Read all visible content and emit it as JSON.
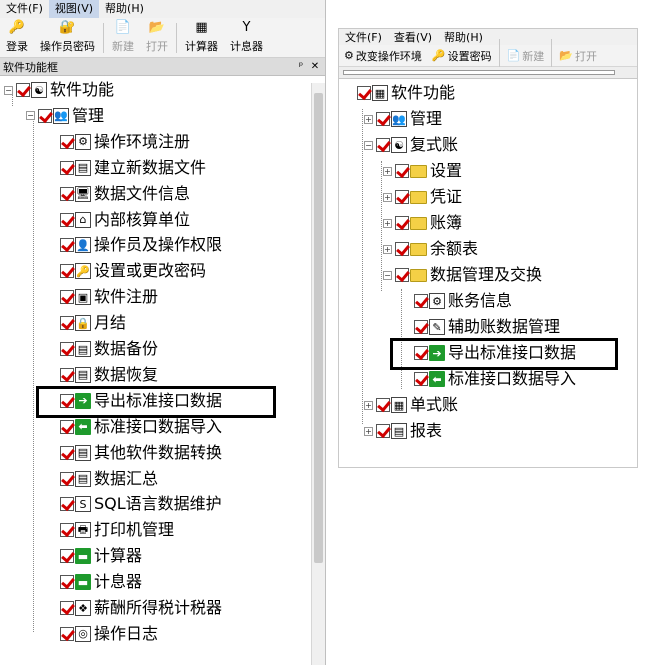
{
  "left": {
    "menu": [
      {
        "label": "文件(F)",
        "selected": false
      },
      {
        "label": "视图(V)",
        "selected": true
      },
      {
        "label": "帮助(H)",
        "selected": false
      }
    ],
    "toolbar": [
      {
        "label": "登录",
        "icon": "key-icon",
        "glyph": "🔑",
        "disabled": false
      },
      {
        "label": "操作员密码",
        "icon": "user-key-icon",
        "glyph": "🔐",
        "disabled": false
      },
      {
        "label": "新建",
        "icon": "new-file-icon",
        "glyph": "📄",
        "disabled": true
      },
      {
        "label": "打开",
        "icon": "open-folder-icon",
        "glyph": "📂",
        "disabled": true
      },
      {
        "label": "计算器",
        "icon": "calculator-icon",
        "glyph": "▦",
        "disabled": false
      },
      {
        "label": "计息器",
        "icon": "interest-calc-icon",
        "glyph": "Y",
        "disabled": false
      }
    ],
    "panel_title": "软件功能框",
    "pin_glyph": "ᵖ",
    "close_glyph": "✕",
    "tree": [
      {
        "label": "软件功能",
        "level": 0,
        "expander": "−",
        "icon": "app-icon",
        "glyph": "☯"
      },
      {
        "label": "管理",
        "level": 1,
        "expander": "−",
        "icon": "manage-icon",
        "glyph": "👥"
      },
      {
        "label": "操作环境注册",
        "level": 2,
        "icon": "env-register-icon",
        "glyph": "⚙"
      },
      {
        "label": "建立新数据文件",
        "level": 2,
        "icon": "new-datafile-icon",
        "glyph": "▤"
      },
      {
        "label": "数据文件信息",
        "level": 2,
        "icon": "datafile-info-icon",
        "glyph": "🖥"
      },
      {
        "label": "内部核算单位",
        "level": 2,
        "icon": "unit-icon",
        "glyph": "⌂"
      },
      {
        "label": "操作员及操作权限",
        "level": 2,
        "icon": "operator-icon",
        "glyph": "👤"
      },
      {
        "label": "设置或更改密码",
        "level": 2,
        "icon": "password-icon",
        "glyph": "🔑"
      },
      {
        "label": "软件注册",
        "level": 2,
        "icon": "software-register-icon",
        "glyph": "▣"
      },
      {
        "label": "月结",
        "level": 2,
        "icon": "month-end-icon",
        "glyph": "🔒"
      },
      {
        "label": "数据备份",
        "level": 2,
        "icon": "backup-icon",
        "glyph": "▤"
      },
      {
        "label": "数据恢复",
        "level": 2,
        "icon": "restore-icon",
        "glyph": "▤"
      },
      {
        "label": "导出标准接口数据",
        "level": 2,
        "icon": "export-icon",
        "glyph": "➔",
        "green": true,
        "highlight": true
      },
      {
        "label": "标准接口数据导入",
        "level": 2,
        "icon": "import-icon",
        "glyph": "⬅",
        "green": true
      },
      {
        "label": "其他软件数据转换",
        "level": 2,
        "icon": "convert-icon",
        "glyph": "▤"
      },
      {
        "label": "数据汇总",
        "level": 2,
        "icon": "summary-icon",
        "glyph": "▤"
      },
      {
        "label": "SQL语言数据维护",
        "level": 2,
        "icon": "sql-icon",
        "glyph": "S"
      },
      {
        "label": "打印机管理",
        "level": 2,
        "icon": "printer-icon",
        "glyph": "🖶"
      },
      {
        "label": "计算器",
        "level": 2,
        "icon": "calculator-icon",
        "glyph": "▬",
        "green": true
      },
      {
        "label": "计息器",
        "level": 2,
        "icon": "interest-calc-icon",
        "glyph": "▬",
        "green": true
      },
      {
        "label": "薪酬所得税计税器",
        "level": 2,
        "icon": "tax-calc-icon",
        "glyph": "❖"
      },
      {
        "label": "操作日志",
        "level": 2,
        "icon": "log-icon",
        "glyph": "◎"
      }
    ]
  },
  "right": {
    "menu": [
      {
        "label": "文件(F)"
      },
      {
        "label": "查看(V)"
      },
      {
        "label": "帮助(H)"
      }
    ],
    "toolbar": [
      {
        "label": "改变操作环境",
        "icon": "change-env-icon",
        "glyph": "⚙",
        "disabled": false
      },
      {
        "label": "设置密码",
        "icon": "set-password-icon",
        "glyph": "🔑",
        "disabled": false
      },
      {
        "label": "新建",
        "icon": "new-file-icon",
        "glyph": "📄",
        "disabled": true
      },
      {
        "label": "打开",
        "icon": "open-folder-icon",
        "glyph": "📂",
        "disabled": true
      }
    ],
    "tree": [
      {
        "label": "软件功能",
        "level": 0,
        "icon": "app-icon",
        "glyph": "▦"
      },
      {
        "label": "管理",
        "level": 1,
        "expander": "+",
        "icon": "manage-icon",
        "glyph": "👥"
      },
      {
        "label": "复式账",
        "level": 1,
        "expander": "−",
        "icon": "ledger-icon",
        "glyph": "☯"
      },
      {
        "label": "设置",
        "level": 2,
        "expander": "+",
        "icon": "folder-icon",
        "folder": true
      },
      {
        "label": "凭证",
        "level": 2,
        "expander": "+",
        "icon": "folder-icon",
        "folder": true
      },
      {
        "label": "账簿",
        "level": 2,
        "expander": "+",
        "icon": "folder-icon",
        "folder": true
      },
      {
        "label": "余额表",
        "level": 2,
        "expander": "+",
        "icon": "folder-icon",
        "folder": true
      },
      {
        "label": "数据管理及交换",
        "level": 2,
        "expander": "−",
        "icon": "folder-open-icon",
        "folder": true
      },
      {
        "label": "账务信息",
        "level": 3,
        "icon": "account-info-icon",
        "glyph": "⚙"
      },
      {
        "label": "辅助账数据管理",
        "level": 3,
        "icon": "aux-data-icon",
        "glyph": "✎"
      },
      {
        "label": "导出标准接口数据",
        "level": 3,
        "icon": "export-icon",
        "glyph": "➔",
        "green": true,
        "highlight": true
      },
      {
        "label": "标准接口数据导入",
        "level": 3,
        "icon": "import-icon",
        "glyph": "⬅",
        "green": true
      },
      {
        "label": "单式账",
        "level": 1,
        "expander": "+",
        "icon": "single-ledger-icon",
        "glyph": "▦"
      },
      {
        "label": "报表",
        "level": 1,
        "expander": "+",
        "icon": "report-icon",
        "glyph": "▤"
      }
    ]
  }
}
